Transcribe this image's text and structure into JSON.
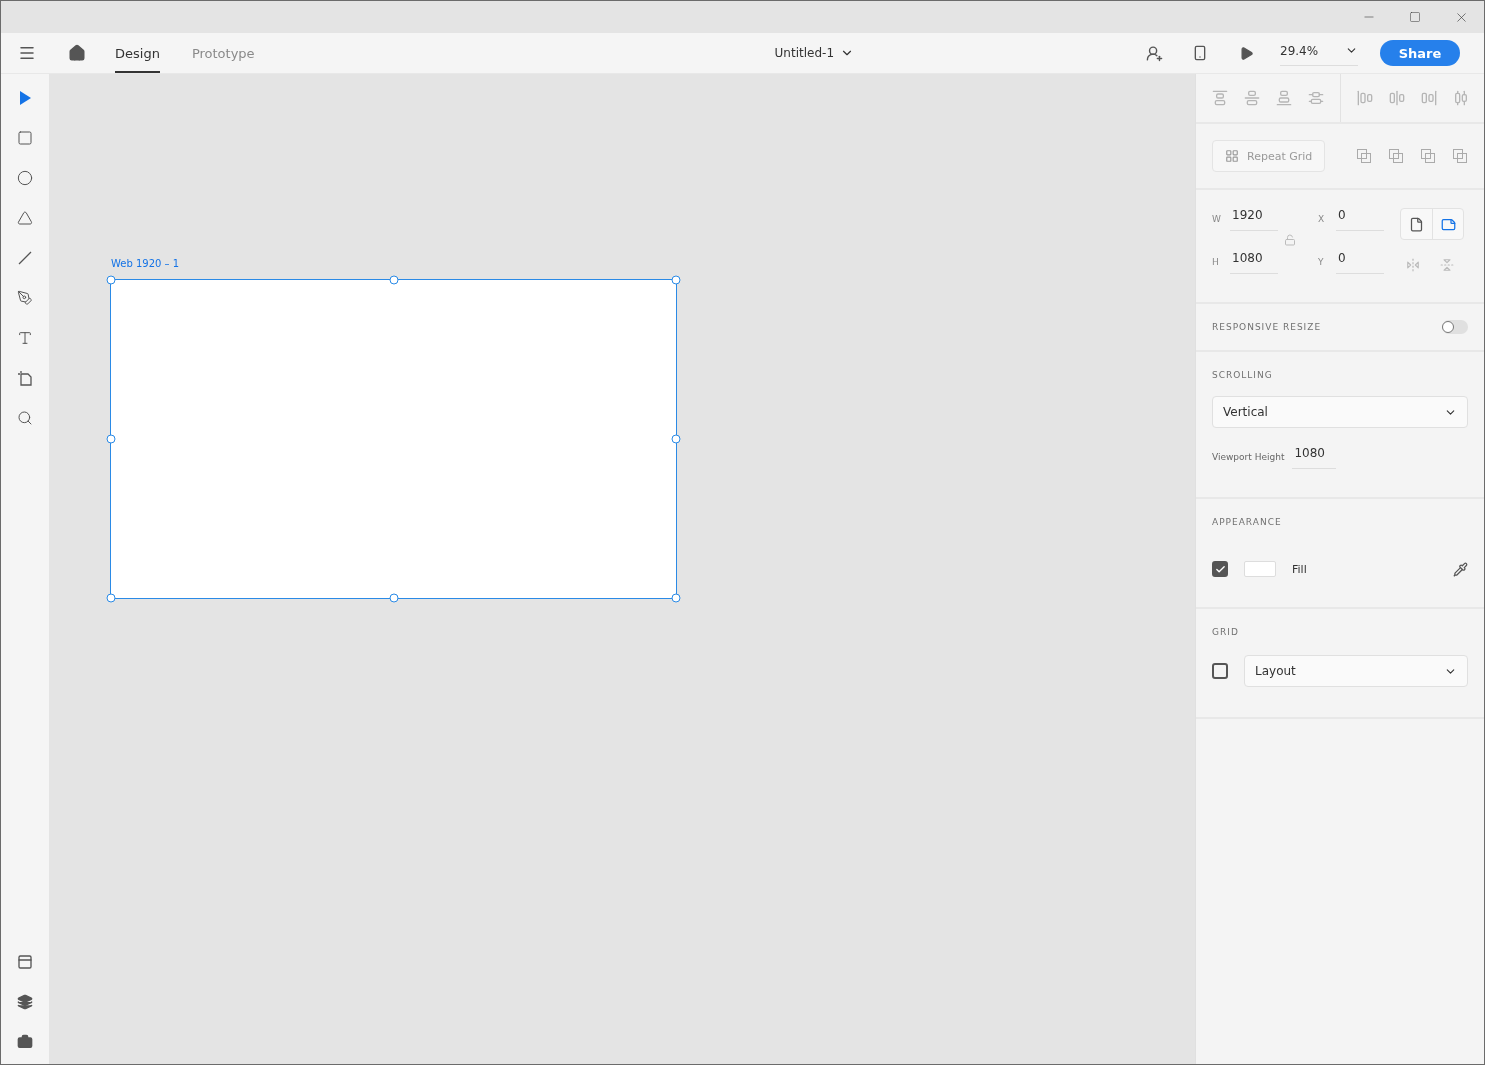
{
  "tabs": [
    {
      "label": "Design",
      "selected": true
    },
    {
      "label": "Prototype",
      "selected": false
    }
  ],
  "document": {
    "title": "Untitled-1"
  },
  "zoom": {
    "value": "29.4%"
  },
  "share_button": "Share",
  "tools": [
    {
      "kind": "select",
      "selected": true
    },
    {
      "kind": "rectangle",
      "selected": false
    },
    {
      "kind": "ellipse",
      "selected": false
    },
    {
      "kind": "polygon",
      "selected": false
    },
    {
      "kind": "line",
      "selected": false
    },
    {
      "kind": "pen",
      "selected": false
    },
    {
      "kind": "text",
      "selected": false
    },
    {
      "kind": "artboard",
      "selected": false
    },
    {
      "kind": "zoom",
      "selected": false
    }
  ],
  "artboard": {
    "label": "Web 1920 – 1",
    "selected": true
  },
  "inspector": {
    "repeat_grid": "Repeat Grid",
    "size": [
      {
        "label": "W",
        "value": "1920"
      },
      {
        "label": "H",
        "value": "1080"
      }
    ],
    "position": [
      {
        "label": "X",
        "value": "0"
      },
      {
        "label": "Y",
        "value": "0"
      }
    ],
    "orientations": [
      {
        "kind": "portrait",
        "selected": false
      },
      {
        "kind": "landscape",
        "selected": true
      }
    ],
    "responsive_resize": {
      "label": "RESPONSIVE RESIZE",
      "on": false
    },
    "scrolling": {
      "label": "SCROLLING",
      "value": "Vertical",
      "viewport_label": "Viewport Height",
      "viewport_value": "1080"
    },
    "appearance": {
      "label": "APPEARANCE",
      "fill_checked": true,
      "fill_label": "Fill"
    },
    "grid": {
      "label": "GRID",
      "checked": false,
      "value": "Layout"
    }
  }
}
